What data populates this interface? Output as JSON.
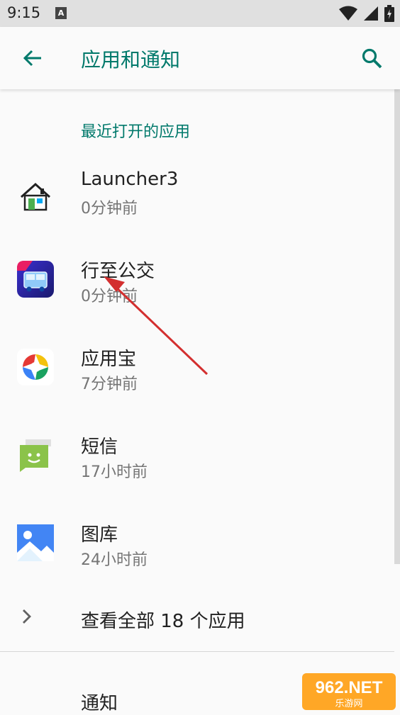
{
  "status": {
    "time": "9:15",
    "a_icon": "A"
  },
  "appbar": {
    "title": "应用和通知"
  },
  "section": {
    "header": "最近打开的应用"
  },
  "apps": [
    {
      "name": "Launcher3",
      "time": "0分钟前",
      "icon": "house-icon"
    },
    {
      "name": "行至公交",
      "time": "0分钟前",
      "icon": "bus-icon"
    },
    {
      "name": "应用宝",
      "time": "7分钟前",
      "icon": "appstore-icon"
    },
    {
      "name": "短信",
      "time": "17小时前",
      "icon": "message-icon"
    },
    {
      "name": "图库",
      "time": "24小时前",
      "icon": "gallery-icon"
    }
  ],
  "see_all": {
    "label": "查看全部 18 个应用"
  },
  "notifications": {
    "label": "通知"
  },
  "watermark": {
    "brand": "962.NET",
    "sub": "乐游网"
  },
  "colors": {
    "accent": "#00796b",
    "arrow": "#d32f2f"
  }
}
